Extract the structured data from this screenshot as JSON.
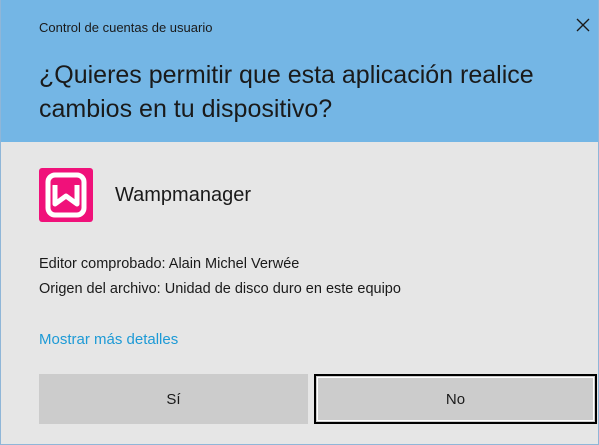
{
  "window": {
    "title": "Control de cuentas de usuario",
    "close_icon": "close-icon"
  },
  "prompt": {
    "question": "¿Quieres permitir que esta aplicación realice cambios en tu dispositivo?"
  },
  "app": {
    "name": "Wampmanager",
    "icon": "wampmanager-icon",
    "icon_color": "#f0117a"
  },
  "info": {
    "publisher": "Editor comprobado: Alain Michel Verwée",
    "origin": "Origen del archivo: Unidad de disco duro en este equipo"
  },
  "links": {
    "more_details": "Mostrar más detalles"
  },
  "buttons": {
    "yes_label": "Sí",
    "no_label": "No"
  },
  "colors": {
    "header_bg": "#74b6e5",
    "body_bg": "#e6e6e6",
    "link": "#1d9ad6",
    "button_bg": "#cccccc"
  }
}
